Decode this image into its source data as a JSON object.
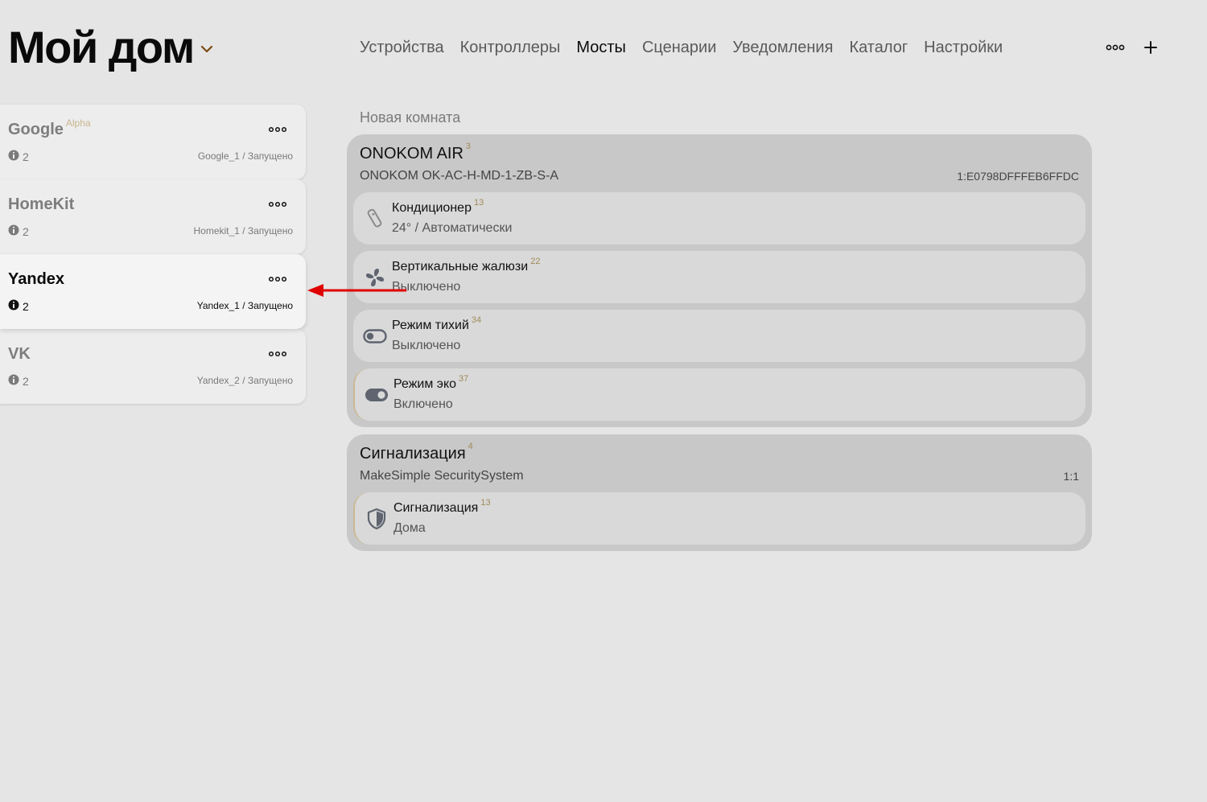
{
  "header": {
    "title": "Мой дом",
    "title_chevron_icon": "chevron-down-icon",
    "accent_color": "#7a4a12",
    "tabs": [
      {
        "label": "Устройства",
        "active": false
      },
      {
        "label": "Контроллеры",
        "active": false
      },
      {
        "label": "Мосты",
        "active": true
      },
      {
        "label": "Сценарии",
        "active": false
      },
      {
        "label": "Уведомления",
        "active": false
      },
      {
        "label": "Каталог",
        "active": false
      },
      {
        "label": "Настройки",
        "active": false
      }
    ],
    "actions": [
      {
        "icon": "more-dots-icon"
      },
      {
        "icon": "plus-icon"
      }
    ]
  },
  "bridges": [
    {
      "name": "Google",
      "tag": "Alpha",
      "count": "2",
      "status": "Google_1 / Запущено",
      "active": false
    },
    {
      "name": "HomeKit",
      "tag": "",
      "count": "2",
      "status": "Homekit_1 / Запущено",
      "active": false
    },
    {
      "name": "Yandex",
      "tag": "",
      "count": "2",
      "status": "Yandex_1 / Запущено",
      "active": true
    },
    {
      "name": "VK",
      "tag": "",
      "count": "2",
      "status": "Yandex_2 / Запущено",
      "active": false
    }
  ],
  "room": {
    "label": "Новая комната"
  },
  "devices": [
    {
      "title": "ONOKOM AIR",
      "title_sup": "3",
      "model": "ONOKOM OK-AC-H-MD-1-ZB-S-A",
      "id": "1:E0798DFFFEB6FFDC",
      "channels": [
        {
          "name": "Кондиционер",
          "sup": "13",
          "value": "24° / Автоматически",
          "icon": "ac-remote-icon"
        },
        {
          "name": "Вертикальные жалюзи",
          "sup": "22",
          "value": "Выключено",
          "icon": "fan-icon"
        },
        {
          "name": "Режим тихий",
          "sup": "34",
          "value": "Выключено",
          "icon": "toggle-off-icon"
        },
        {
          "name": "Режим эко",
          "sup": "37",
          "value": "Включено",
          "icon": "toggle-on-icon"
        }
      ]
    },
    {
      "title": "Сигнализация",
      "title_sup": "4",
      "model": "MakeSimple SecuritySystem",
      "id": "1:1",
      "channels": [
        {
          "name": "Сигнализация",
          "sup": "13",
          "value": "Дома",
          "icon": "shield-icon"
        }
      ]
    }
  ],
  "annotation": {
    "color": "#e00000",
    "icon": "red-arrow-left-icon"
  }
}
